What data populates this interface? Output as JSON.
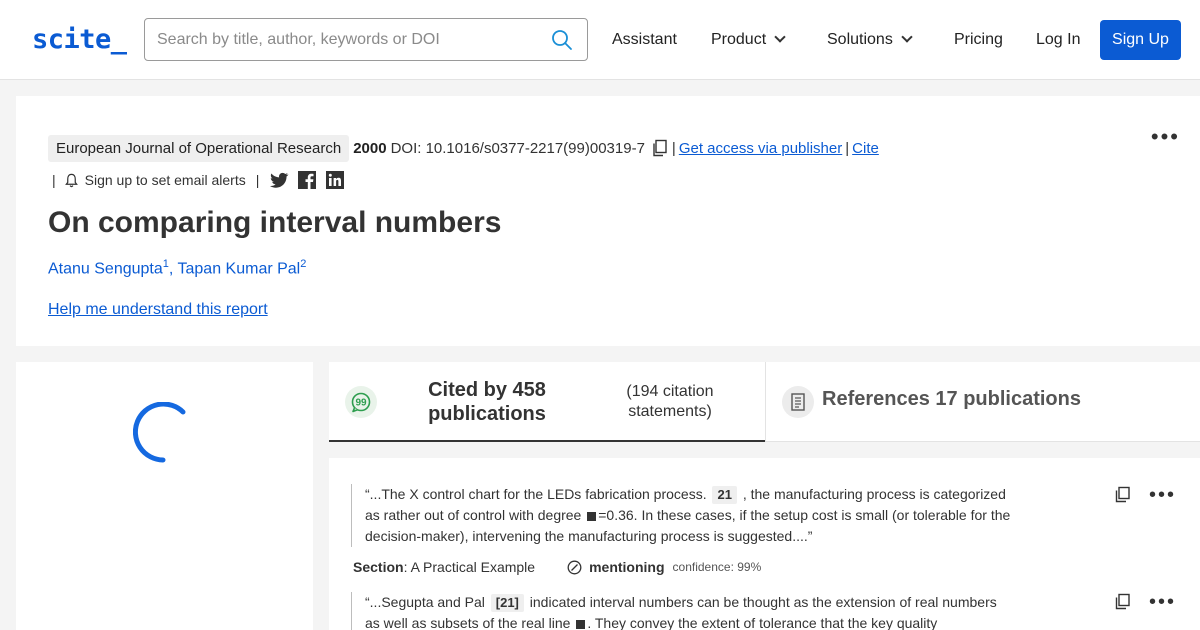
{
  "header": {
    "logo": "scite_",
    "search_placeholder": "Search by title, author, keywords or DOI",
    "nav": {
      "assistant": "Assistant",
      "product": "Product",
      "solutions": "Solutions",
      "pricing": "Pricing",
      "login": "Log In",
      "signup": "Sign Up"
    }
  },
  "paper": {
    "journal": "European Journal of Operational Research",
    "year": "2000",
    "doi": "DOI: 10.1016/s0377-2217(99)00319-7",
    "get_access": "Get access via publisher",
    "cite": "Cite",
    "alert_text": "Sign up to set email alerts",
    "title": "On comparing interval numbers",
    "authors": [
      {
        "name": "Atanu Sengupta",
        "sup": "1"
      },
      {
        "name": "Tapan Kumar Pal",
        "sup": "2"
      }
    ],
    "help_link": "Help me understand this report"
  },
  "tabs": {
    "cited_title": "Cited by 458 publications",
    "cited_sub": "(194 citation statements)",
    "refs_title": "References 17 publications"
  },
  "citations": [
    {
      "quote_pre": "“...The X control chart for the LEDs fabrication process.",
      "ref": "21",
      "quote_mid": ", the manufacturing process is categorized as rather out of control with degree",
      "quote_post": "=0.36. In these cases, if the setup cost is small (or tolerable for the decision-maker), intervening the manufacturing process is suggested....”",
      "section_label": "Section",
      "section": ": A Practical Example",
      "type": "mentioning",
      "confidence": "confidence: 99%"
    },
    {
      "quote_pre": "“...Segupta and Pal",
      "ref": "[21]",
      "quote_mid": "indicated interval numbers can be thought as the extension of real numbers as well as subsets of the real line",
      "quote_post": ". They convey the extent of tolerance that the key quality characteristic"
    }
  ],
  "colors": {
    "brand": "#0b5bd3",
    "background": "#f4f4f4",
    "mention_green": "#2e9e4f"
  },
  "icons": [
    "search-icon",
    "chevron-down-icon",
    "copy-icon",
    "bell-icon",
    "twitter-icon",
    "facebook-icon",
    "linkedin-icon",
    "more-dots-icon",
    "loading-spinner",
    "speech-bubble-icon",
    "document-icon",
    "mentioning-icon"
  ]
}
